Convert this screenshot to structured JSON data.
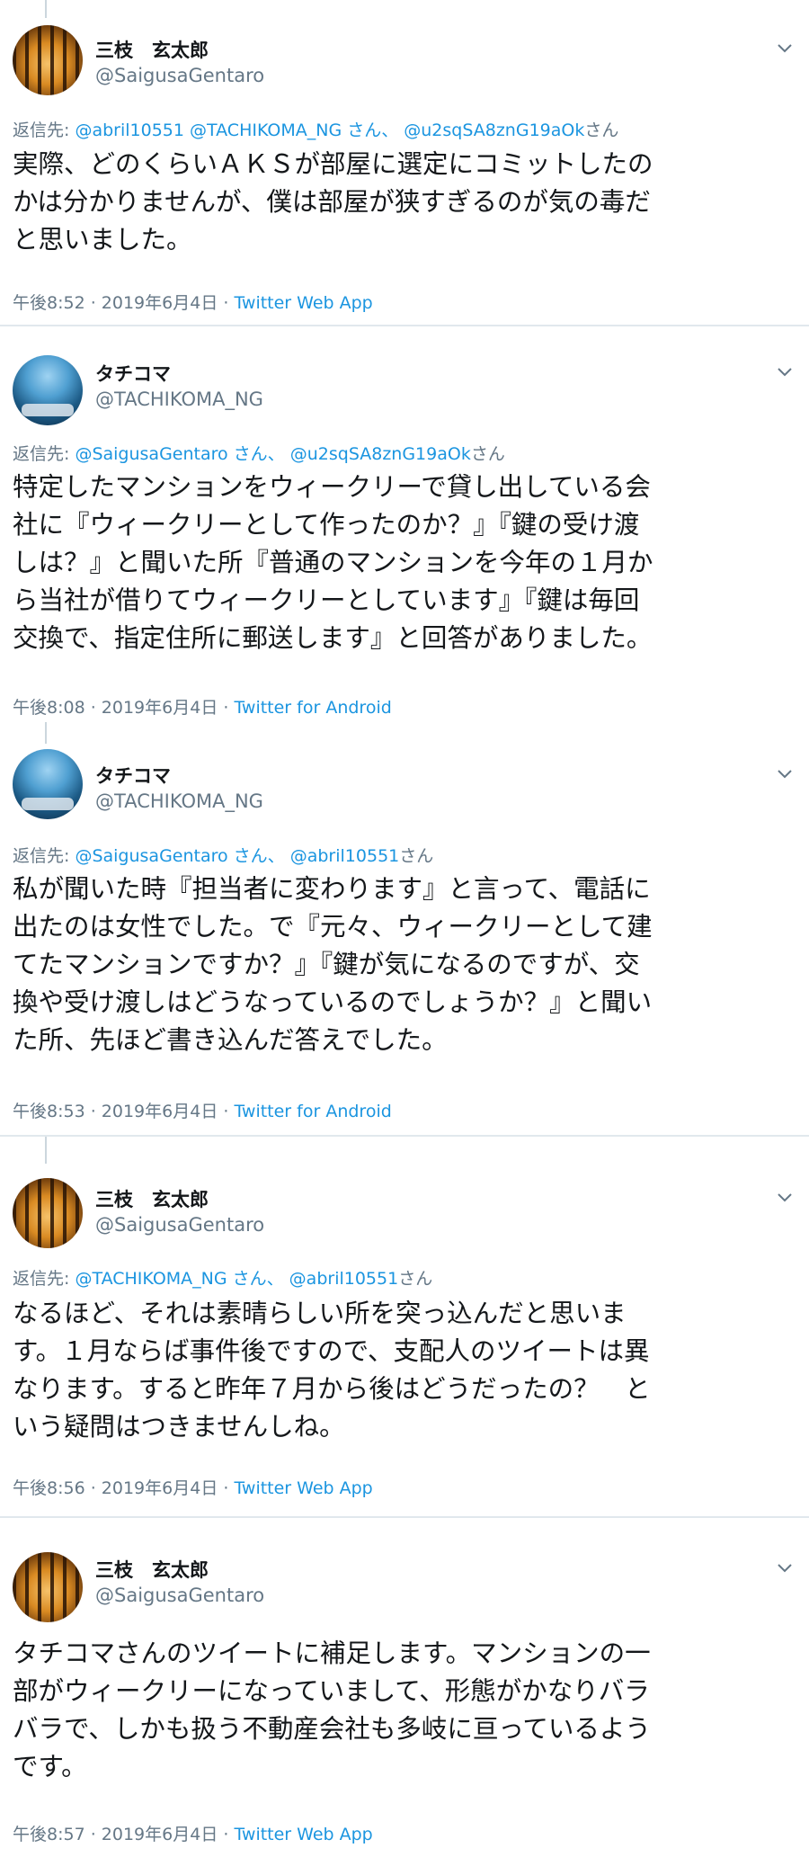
{
  "tweets": [
    {
      "name": "三枝　玄太郎",
      "handle": "@SaigusaGentaro",
      "reply_label": "返信先:",
      "reply_mentions": "@abril10551 @TACHIKOMA_NG さん、 @u2sqSA8znG19aOk",
      "reply_suffix": "さん",
      "text": "実際、どのくらいＡＫＳが部屋に選定にコミットしたの\nかは分かりませんが、僕は部屋が狭すぎるのが気の毒だ\nと思いました。",
      "time": "午後8:52 · 2019年6月4日 · ",
      "source": "Twitter Web App"
    },
    {
      "name": "タチコマ",
      "handle": "@TACHIKOMA_NG",
      "reply_label": "返信先:",
      "reply_mentions": "@SaigusaGentaro さん、 @u2sqSA8znG19aOk",
      "reply_suffix": "さん",
      "text": "特定したマンションをウィークリーで貸し出している会\n社に『ウィークリーとして作ったのか？』『鍵の受け渡\nしは？』と聞いた所『普通のマンションを今年の１月か\nら当社が借りてウィークリーとしています』『鍵は毎回\n交換で、指定住所に郵送します』と回答がありました。",
      "time": "午後8:08 · 2019年6月4日 · ",
      "source": "Twitter for Android"
    },
    {
      "name": "タチコマ",
      "handle": "@TACHIKOMA_NG",
      "reply_label": "返信先:",
      "reply_mentions": "@SaigusaGentaro さん、 @abril10551",
      "reply_suffix": "さん",
      "text": "私が聞いた時『担当者に変わります』と言って、電話に\n出たのは女性でした。で『元々、ウィークリーとして建\nてたマンションですか？』『鍵が気になるのですが、交\n換や受け渡しはどうなっているのでしょうか？』と聞い\nた所、先ほど書き込んだ答えでした。",
      "time": "午後8:53 · 2019年6月4日 · ",
      "source": "Twitter for Android"
    },
    {
      "name": "三枝　玄太郎",
      "handle": "@SaigusaGentaro",
      "reply_label": "返信先:",
      "reply_mentions": "@TACHIKOMA_NG さん、 @abril10551",
      "reply_suffix": "さん",
      "text": "なるほど、それは素晴らしい所を突っ込んだと思いま\nす。１月ならば事件後ですので、支配人のツイートは異\nなります。すると昨年７月から後はどうだったの？　と\nいう疑問はつきませんしね。",
      "time": "午後8:56 · 2019年6月4日 · ",
      "source": "Twitter Web App"
    },
    {
      "name": "三枝　玄太郎",
      "handle": "@SaigusaGentaro",
      "text": "タチコマさんのツイートに補足します。マンションの一\n部がウィークリーになっていまして、形態がかなりバラ\nバラで、しかも扱う不動産会社も多岐に亘っているよう\nです。",
      "time": "午後8:57 · 2019年6月4日 · ",
      "source": "Twitter Web App"
    }
  ],
  "icons": {
    "chevron": "chevron-down-icon"
  },
  "colors": {
    "link": "#1b95e0",
    "secondary": "#657786",
    "text": "#14171a",
    "divider": "#e1e8ed"
  }
}
